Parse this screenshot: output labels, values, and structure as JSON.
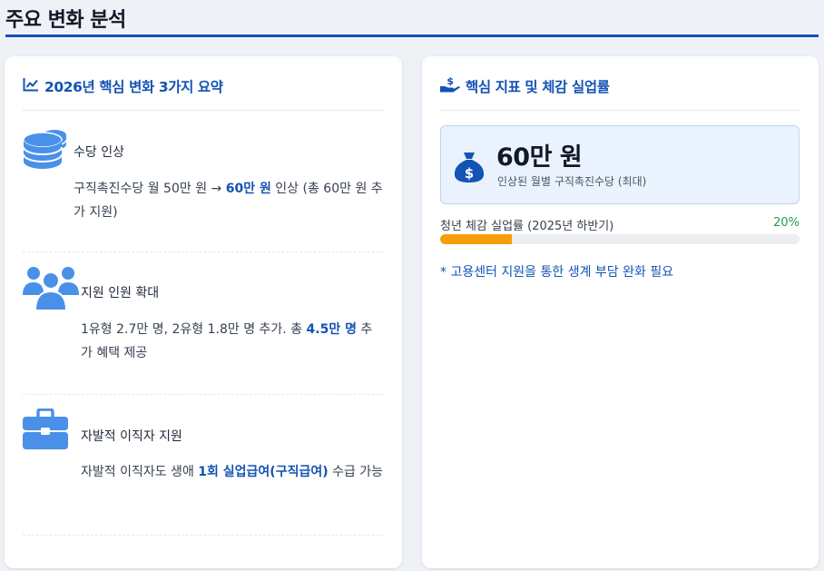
{
  "page": {
    "title": "주요 변화 분석"
  },
  "summary": {
    "heading": "2026년 핵심 변화 3가지 요약",
    "heading_icon": "chart-line-icon",
    "items": [
      {
        "icon": "coins-icon",
        "name": "수당 인상",
        "desc_pre": "구직촉진수당 월 50만 원 → ",
        "desc_bold": "60만 원",
        "desc_post": " 인상 (총 60만 원 추가 지원)"
      },
      {
        "icon": "users-icon",
        "name": "지원 인원 확대",
        "desc_pre": "1유형 2.7만 명, 2유형 1.8만 명 추가. 총 ",
        "desc_bold": "4.5만 명",
        "desc_post": " 추가 혜택 제공"
      },
      {
        "icon": "briefcase-icon",
        "name": "자발적 이직자 지원",
        "desc_pre": "자발적 이직자도 생애 ",
        "desc_bold": "1회 실업급여(구직급여)",
        "desc_post": " 수급 가능"
      }
    ]
  },
  "indicators": {
    "heading": "핵심 지표 및 체감 실업률",
    "heading_icon": "hand-holding-dollar-icon",
    "stat": {
      "icon": "money-bag-icon",
      "value": "60만 원",
      "label": "인상된 월별 구직촉진수당 (최대)"
    },
    "progress": {
      "label": "청년 체감 실업률 (2025년 하반기)",
      "value_text": "20%",
      "percent": 20
    },
    "note": "* 고용센터 지원을 통한 생계 부담 완화 필요"
  },
  "colors": {
    "accent": "#1353b5",
    "icon_blue": "#4a90e8",
    "progress_fill": "#f59e0b",
    "progress_value": "#1f9d55"
  }
}
